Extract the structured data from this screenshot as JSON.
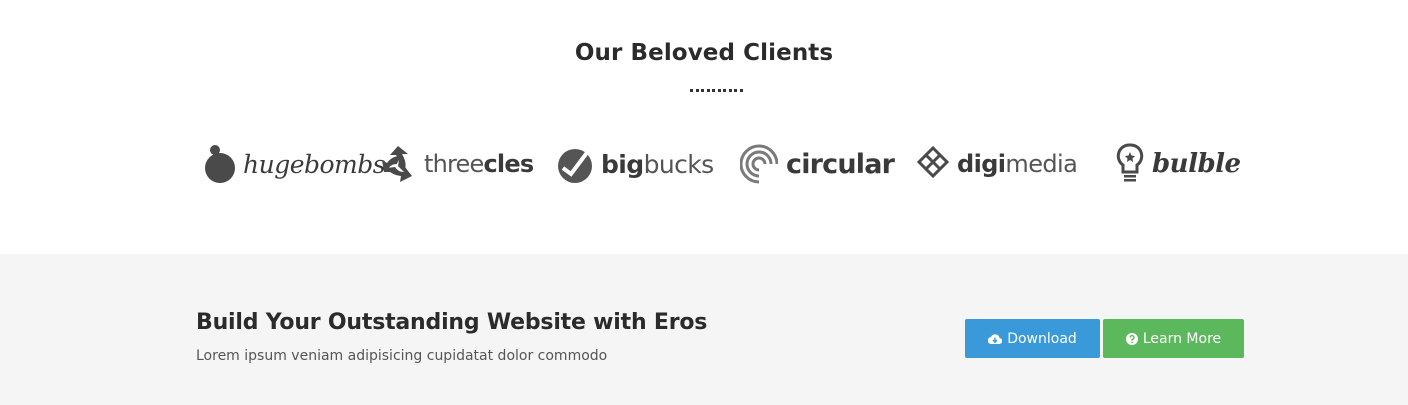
{
  "clients": {
    "title": "Our Beloved Clients",
    "logos": [
      {
        "name": "hugebombs",
        "parts": [
          "hugebombs"
        ]
      },
      {
        "name": "threecles",
        "parts": [
          "three",
          "cles"
        ]
      },
      {
        "name": "bigbucks",
        "parts": [
          "big",
          "bucks"
        ]
      },
      {
        "name": "circular",
        "parts": [
          "circular"
        ]
      },
      {
        "name": "digimedia",
        "parts": [
          "digi",
          "media"
        ]
      },
      {
        "name": "bulble",
        "parts": [
          "bulble"
        ]
      }
    ]
  },
  "cta": {
    "title": "Build Your Outstanding Website with Eros",
    "subtitle": "Lorem ipsum veniam adipisicing cupidatat dolor commodo",
    "download_label": "Download",
    "learn_more_label": "Learn More",
    "download_icon": "cloud-download-icon",
    "learn_more_icon": "question-circle-icon"
  },
  "colors": {
    "download_button": "#3a9ad9",
    "learn_more_button": "#5cb85c",
    "cta_background": "#f5f5f5"
  }
}
